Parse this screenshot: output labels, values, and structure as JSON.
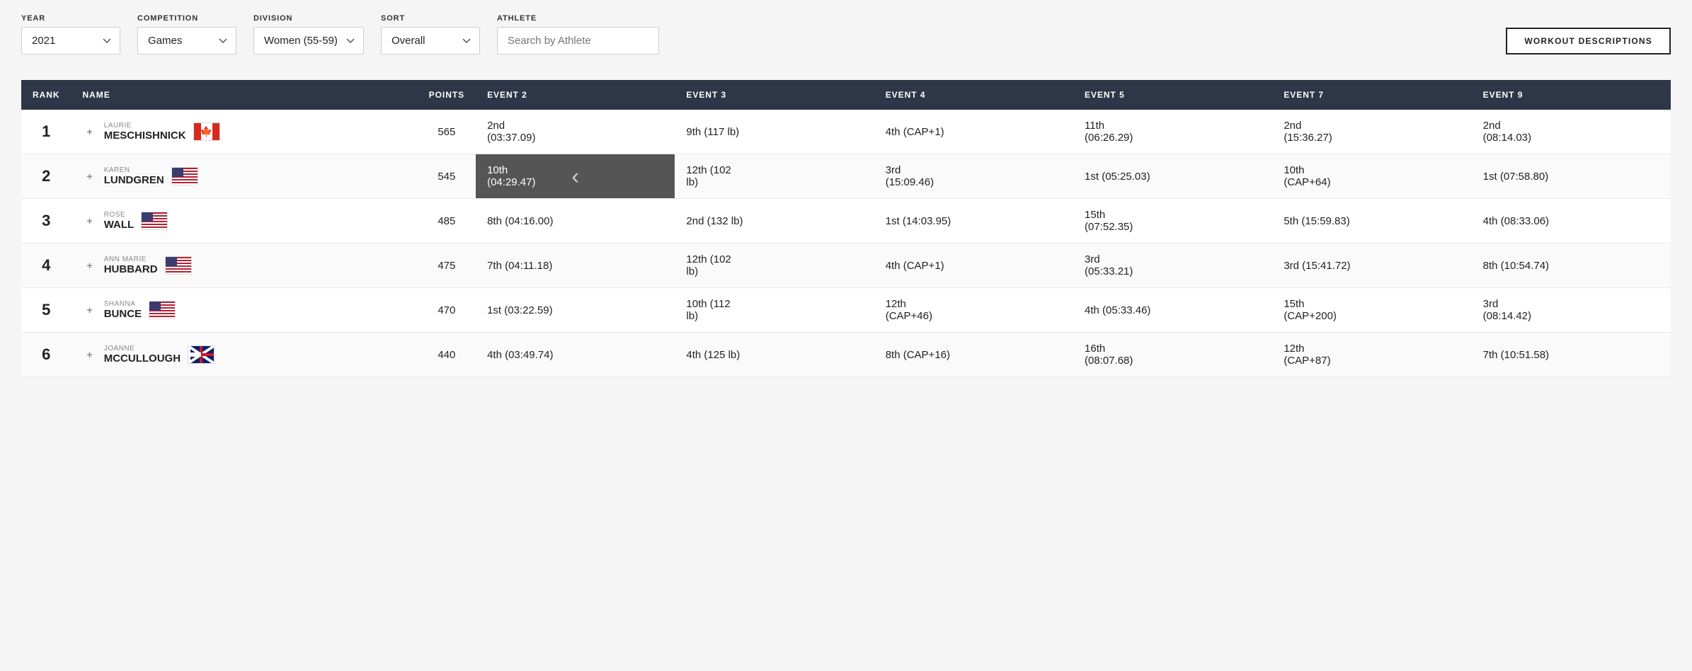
{
  "filters": {
    "year_label": "YEAR",
    "year_value": "2021",
    "competition_label": "COMPETITION",
    "competition_value": "Games",
    "division_label": "DIVISION",
    "division_value": "Women (55-59)",
    "sort_label": "SORT",
    "sort_value": "Overall",
    "athlete_label": "ATHLETE",
    "athlete_placeholder": "Search by Athlete",
    "workout_btn": "WORKOUT DESCRIPTIONS"
  },
  "table": {
    "headers": [
      "RANK",
      "NAME",
      "POINTS",
      "EVENT 2",
      "EVENT 3",
      "EVENT 4",
      "EVENT 5",
      "EVENT 7",
      "EVENT 9"
    ],
    "rows": [
      {
        "rank": "1",
        "first_name": "LAURIE",
        "last_name": "MESCHISHNICK",
        "flag": "canada",
        "points": "565",
        "event2": "2nd\n(03:37.09)",
        "event3": "9th (117 lb)",
        "event4": "4th (CAP+1)",
        "event5": "11th\n(06:26.29)",
        "event7": "2nd\n(15:36.27)",
        "event9": "2nd\n(08:14.03)",
        "highlighted": false
      },
      {
        "rank": "2",
        "first_name": "KAREN",
        "last_name": "LUNDGREN",
        "flag": "us",
        "points": "545",
        "event2": "10th\n(04:29.47)",
        "event3": "12th (102\nlb)",
        "event4": "3rd\n(15:09.46)",
        "event5": "1st (05:25.03)",
        "event7": "10th\n(CAP+64)",
        "event9": "1st (07:58.80)",
        "highlighted": true
      },
      {
        "rank": "3",
        "first_name": "ROSE",
        "last_name": "WALL",
        "flag": "us",
        "points": "485",
        "event2": "8th (04:16.00)",
        "event3": "2nd (132 lb)",
        "event4": "1st (14:03.95)",
        "event5": "15th\n(07:52.35)",
        "event7": "5th (15:59.83)",
        "event9": "4th (08:33.06)",
        "highlighted": false
      },
      {
        "rank": "4",
        "first_name": "ANN MARIE",
        "last_name": "HUBBARD",
        "flag": "us",
        "points": "475",
        "event2": "7th (04:11.18)",
        "event3": "12th (102\nlb)",
        "event4": "4th (CAP+1)",
        "event5": "3rd\n(05:33.21)",
        "event7": "3rd (15:41.72)",
        "event9": "8th (10:54.74)",
        "highlighted": false
      },
      {
        "rank": "5",
        "first_name": "SHANNA",
        "last_name": "BUNCE",
        "flag": "us",
        "points": "470",
        "event2": "1st (03:22.59)",
        "event3": "10th (112\nlb)",
        "event4": "12th\n(CAP+46)",
        "event5": "4th (05:33.46)",
        "event7": "15th\n(CAP+200)",
        "event9": "3rd\n(08:14.42)",
        "highlighted": false
      },
      {
        "rank": "6",
        "first_name": "JOANNE",
        "last_name": "MCCULLOUGH",
        "flag": "uk",
        "points": "440",
        "event2": "4th (03:49.74)",
        "event3": "4th (125 lb)",
        "event4": "8th (CAP+16)",
        "event5": "16th\n(08:07.68)",
        "event7": "12th\n(CAP+87)",
        "event9": "7th (10:51.58)",
        "highlighted": false
      }
    ]
  }
}
